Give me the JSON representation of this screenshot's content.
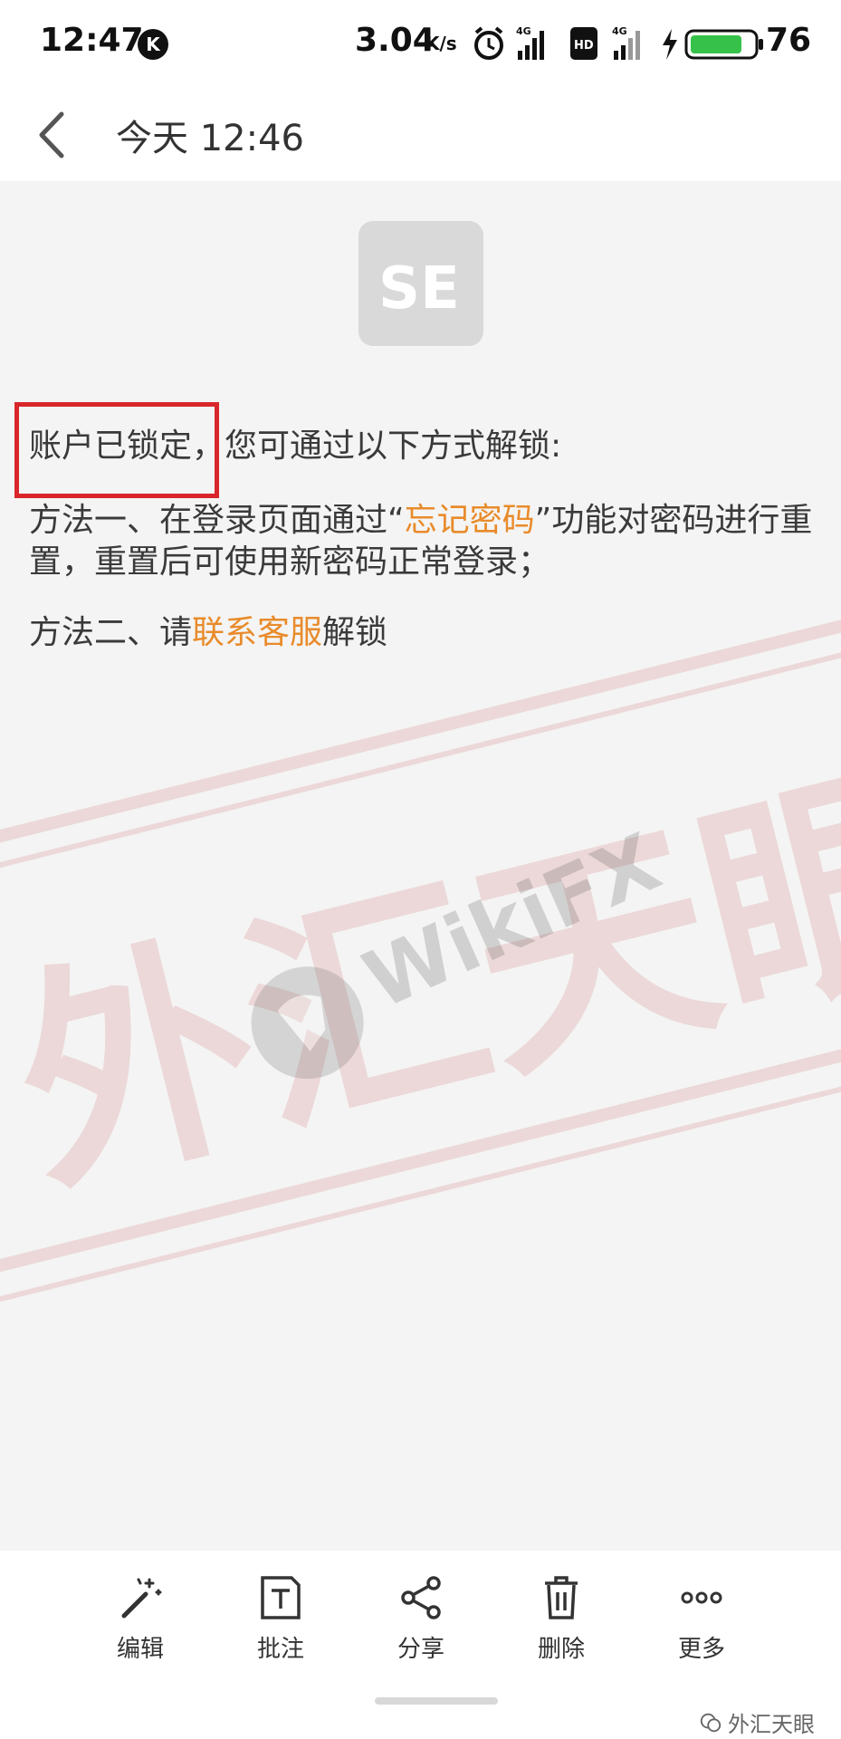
{
  "status_bar": {
    "time": "12:47",
    "k_badge": "K",
    "net_speed": "3.04",
    "net_speed_unit": "K/s",
    "battery_percent": "76"
  },
  "header": {
    "title": "今天 12:46"
  },
  "logo": {
    "text": "SE"
  },
  "message": {
    "line1_locked": "账户已锁定，",
    "line1_rest": "您可通过以下方式解锁:",
    "method1_prefix": "方法一、在登录页面通过“",
    "method1_link": "忘记密码",
    "method1_suffix": "”功能对密码进行重置，重置后可使用新密码正常登录；",
    "method2_prefix": "方法二、请",
    "method2_link": "联系客服",
    "method2_suffix": "解锁"
  },
  "watermark": {
    "brand_latin": "WikiFX",
    "brand_cn": "外汇天眼"
  },
  "toolbar": {
    "edit": "编辑",
    "annotate": "批注",
    "share": "分享",
    "delete": "删除",
    "more": "更多"
  },
  "footer_brand": "外汇天眼",
  "colors": {
    "accent_link": "#e98b2b",
    "highlight_border": "#d8262b"
  }
}
